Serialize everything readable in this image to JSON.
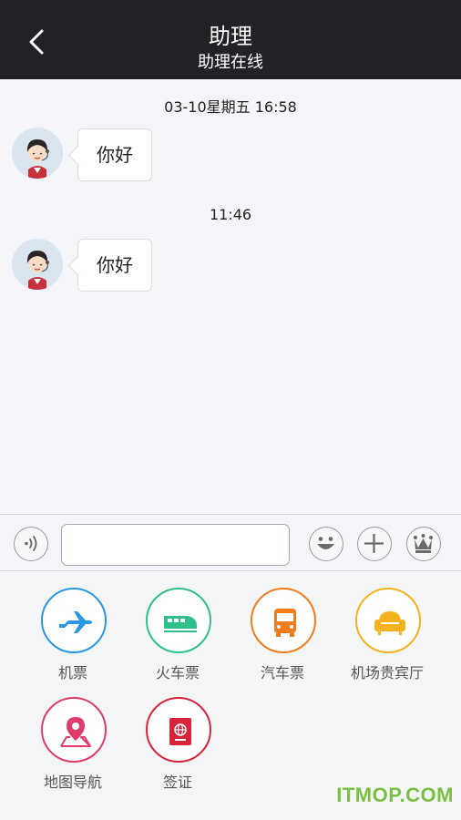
{
  "header": {
    "title": "助理",
    "subtitle": "助理在线"
  },
  "chat": {
    "messages": [
      {
        "time": "03-10星期五 16:58",
        "text": "你好"
      },
      {
        "time": "11:46",
        "text": "你好"
      }
    ]
  },
  "input": {
    "value": "",
    "placeholder": ""
  },
  "services": [
    {
      "label": "机票",
      "color": "#2a97e4",
      "icon": "airplane-icon"
    },
    {
      "label": "火车票",
      "color": "#2dc08b",
      "icon": "train-icon"
    },
    {
      "label": "汽车票",
      "color": "#f07c1a",
      "icon": "bus-icon"
    },
    {
      "label": "机场贵宾厅",
      "color": "#f4b21c",
      "icon": "sofa-icon"
    },
    {
      "label": "地图导航",
      "color": "#e13b6c",
      "icon": "map-pin-icon"
    },
    {
      "label": "签证",
      "color": "#d8243a",
      "icon": "passport-icon"
    }
  ],
  "watermark": "ITMOP.COM"
}
